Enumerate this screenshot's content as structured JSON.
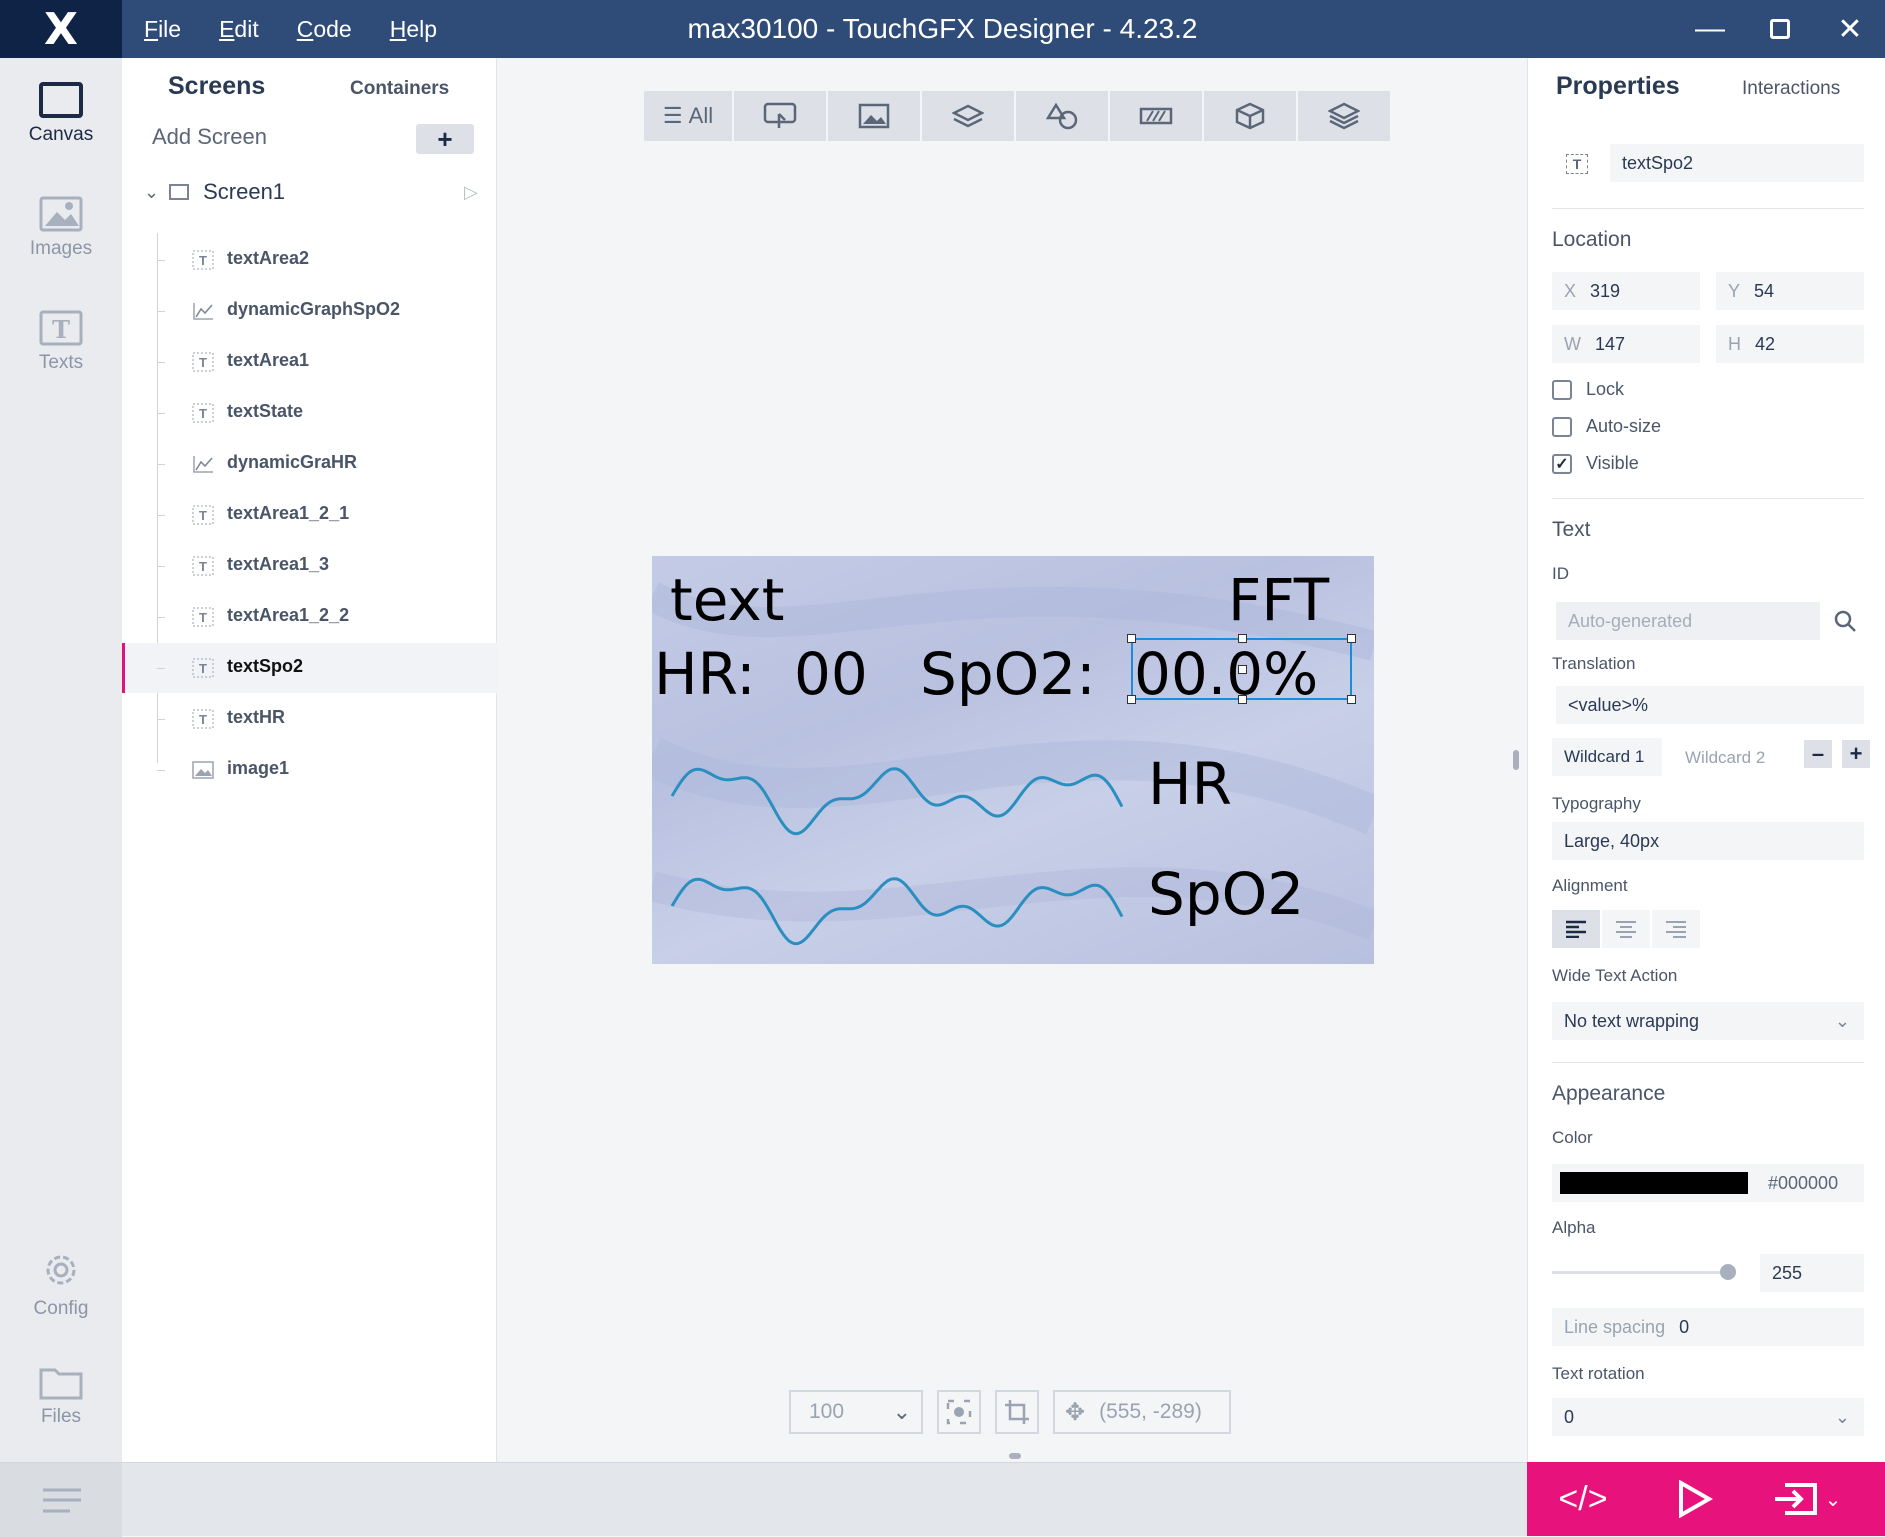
{
  "app": {
    "title": "max30100 - TouchGFX Designer - 4.23.2",
    "menu": [
      "File",
      "Edit",
      "Code",
      "Help"
    ]
  },
  "nav": [
    {
      "label": "Canvas"
    },
    {
      "label": "Images"
    },
    {
      "label": "Texts"
    },
    {
      "label": "Config"
    },
    {
      "label": "Files"
    }
  ],
  "tree": {
    "tabs": [
      "Screens",
      "Containers"
    ],
    "add_screen": "Add Screen",
    "screen": "Screen1",
    "items": [
      {
        "label": "textArea2",
        "icon": "text"
      },
      {
        "label": "dynamicGraphSpO2",
        "icon": "graph"
      },
      {
        "label": "textArea1",
        "icon": "text"
      },
      {
        "label": "textState",
        "icon": "text"
      },
      {
        "label": "dynamicGraHR",
        "icon": "graph"
      },
      {
        "label": "textArea1_2_1",
        "icon": "text"
      },
      {
        "label": "textArea1_3",
        "icon": "text"
      },
      {
        "label": "textArea1_2_2",
        "icon": "text"
      },
      {
        "label": "textSpo2",
        "icon": "text",
        "selected": true
      },
      {
        "label": "textHR",
        "icon": "text"
      },
      {
        "label": "image1",
        "icon": "image"
      }
    ]
  },
  "toolbar": {
    "all": "All"
  },
  "screen": {
    "t1": "text",
    "t2": "FFT",
    "t3": "HR:",
    "t4": "00",
    "t5": "SpO2:",
    "t6": "00.0%",
    "t7": "HR",
    "t8": "SpO2",
    "wave_color": "#2a8fc0"
  },
  "canvas_ctl": {
    "zoom": "100",
    "coords": "(555, -289)"
  },
  "props": {
    "tabs": [
      "Properties",
      "Interactions"
    ],
    "name": "textSpo2",
    "location": {
      "title": "Location",
      "x": "319",
      "y": "54",
      "w": "147",
      "h": "42",
      "lock": "Lock",
      "autosize": "Auto-size",
      "visible": "Visible"
    },
    "text": {
      "title": "Text",
      "id_label": "ID",
      "id_placeholder": "Auto-generated",
      "translation_label": "Translation",
      "translation": "<value>%",
      "wildcard1": "Wildcard 1",
      "wildcard2": "Wildcard 2",
      "typography_label": "Typography",
      "typography": "Large, 40px",
      "alignment_label": "Alignment",
      "wide_label": "Wide Text Action",
      "wide": "No text wrapping"
    },
    "appearance": {
      "title": "Appearance",
      "color_label": "Color",
      "color": "#000000",
      "alpha_label": "Alpha",
      "alpha": "255",
      "line_spacing_label": "Line spacing",
      "line_spacing": "0",
      "rotation_label": "Text rotation",
      "rotation": "0"
    }
  }
}
